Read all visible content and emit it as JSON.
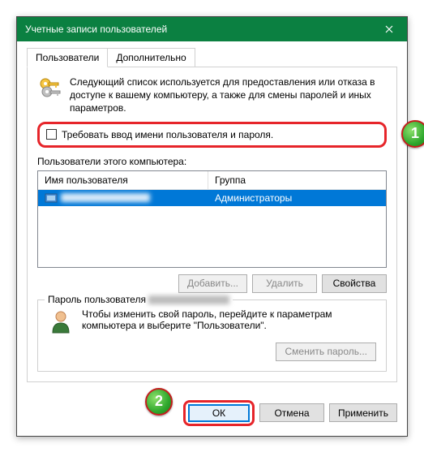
{
  "window": {
    "title": "Учетные записи пользователей"
  },
  "tabs": {
    "users": "Пользователи",
    "advanced": "Дополнительно"
  },
  "info": {
    "text": "Следующий список используется для предоставления или отказа в доступе к вашему компьютеру, а также для смены паролей и иных параметров."
  },
  "checkbox": {
    "label": "Требовать ввод имени пользователя и пароля."
  },
  "users_list": {
    "caption": "Пользователи этого компьютера:",
    "columns": {
      "name": "Имя пользователя",
      "group": "Группа"
    },
    "rows": [
      {
        "group": "Администраторы"
      }
    ]
  },
  "buttons": {
    "add": "Добавить...",
    "remove": "Удалить",
    "properties": "Свойства",
    "change_password": "Сменить пароль...",
    "ok": "ОК",
    "cancel": "Отмена",
    "apply": "Применить"
  },
  "password_group": {
    "title_prefix": "Пароль пользователя",
    "text": "Чтобы изменить свой пароль, перейдите к параметрам компьютера и выберите \"Пользователи\"."
  },
  "annotations": {
    "step1": "1",
    "step2": "2"
  }
}
